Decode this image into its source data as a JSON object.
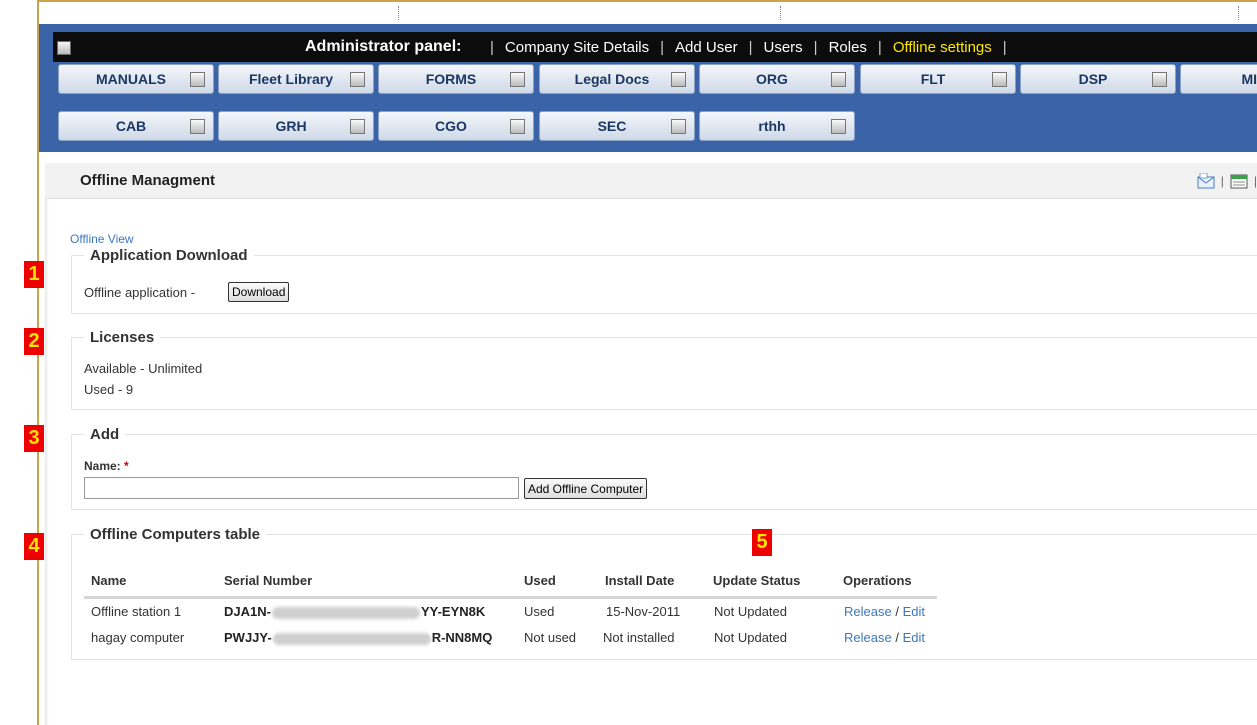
{
  "admin_bar": {
    "title": "Administrator panel:",
    "links": [
      "Company Site Details",
      "Add User",
      "Users",
      "Roles",
      "Offline settings"
    ],
    "active_link": "Offline settings",
    "separator": "|"
  },
  "tabs_row1": [
    "MANUALS",
    "Fleet Library",
    "FORMS",
    "Legal Docs",
    "ORG",
    "FLT",
    "DSP",
    "MI"
  ],
  "tabs_row2": [
    "CAB",
    "GRH",
    "CGO",
    "SEC",
    "rthh"
  ],
  "header": {
    "title": "Offline Managment",
    "tool_separator": "|"
  },
  "offline_view_link": "Offline View",
  "application_download": {
    "legend": "Application Download",
    "label": "Offline application -",
    "button": "Download"
  },
  "licenses": {
    "legend": "Licenses",
    "available": "Available - Unlimited",
    "used": "Used - 9"
  },
  "add": {
    "legend": "Add",
    "name_label": "Name:",
    "required_mark": "*",
    "name_value": "",
    "button": "Add Offline Computer"
  },
  "table": {
    "legend": "Offline Computers table",
    "headers": [
      "Name",
      "Serial Number",
      "Used",
      "Install Date",
      "Update Status",
      "Operations"
    ],
    "rows": [
      {
        "name": "Offline station 1",
        "serial_start": "DJA1N-",
        "serial_end": "YY-EYN8K",
        "used": "Used",
        "install_date": "15-Nov-2011",
        "update_status": "Not Updated",
        "release": "Release",
        "slash": "/",
        "edit": "Edit"
      },
      {
        "name": "hagay computer",
        "serial_start": "PWJJY-",
        "serial_end": "R-NN8MQ",
        "used": "Not used",
        "install_date": "Not installed",
        "update_status": "Not Updated",
        "release": "Release",
        "slash": "/",
        "edit": "Edit"
      }
    ]
  },
  "badges": [
    "1",
    "2",
    "3",
    "4",
    "5"
  ],
  "colors": {
    "nav_blue": "#3b64a8",
    "admin_black": "#0c0c0c",
    "active_link": "#ffe600",
    "badge_red": "#ee0000",
    "link_blue": "#3c78c0"
  },
  "icons": {
    "header_tool_1": "email-icon",
    "header_tool_2": "calendar-icon",
    "edit": "edit-pencil-icon"
  }
}
